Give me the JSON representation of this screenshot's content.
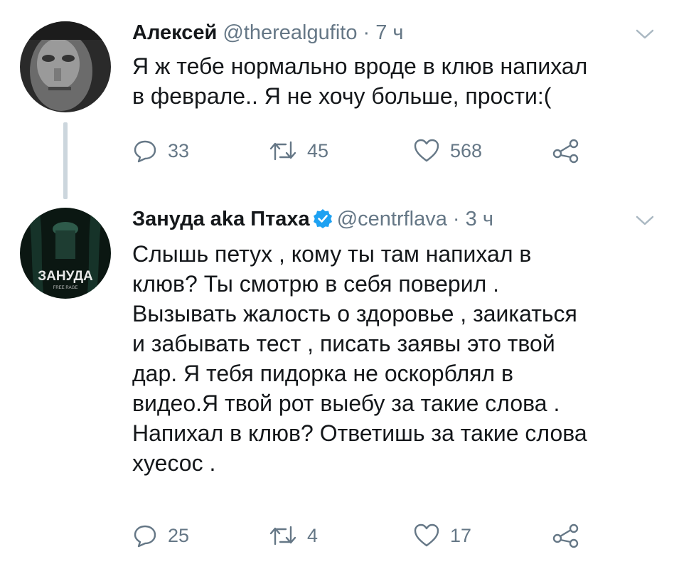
{
  "tweets": [
    {
      "name": "Алексей",
      "handle": "@therealgufito",
      "separator": "·",
      "time": "7 ч",
      "text": "Я ж тебе нормально вроде в клюв напихал\nв феврале.. Я не хочу больше, прости:(",
      "replies": "33",
      "retweets": "45",
      "likes": "568",
      "avatar_icon": "bw-face-photo"
    },
    {
      "name": "Зануда aka Птаха",
      "handle": "@centrflava",
      "separator": "·",
      "time": "3 ч",
      "verified": true,
      "text": "Слышь петух , кому ты там напихал в\nклюв? Ты смотрю в себя поверил .\nВызывать жалость о здоровье , заикаться\nи забывать тест , писать заявы это твой\nдар. Я тебя пидорка не оскорблял в\nвидео.Я твой рот выебу за такие слова .\nНапихал в клюв? Ответишь за такие слова\nхуесос .",
      "replies": "25",
      "retweets": "4",
      "likes": "17",
      "avatar_icon": "album-cover",
      "avatar_title": "ЗАНУДА",
      "avatar_subtitle": "FREE RAGE"
    }
  ],
  "colors": {
    "text": "#14171a",
    "secondary": "#657786",
    "verified": "#1da1f2",
    "thread_line": "#ccd6dd"
  }
}
